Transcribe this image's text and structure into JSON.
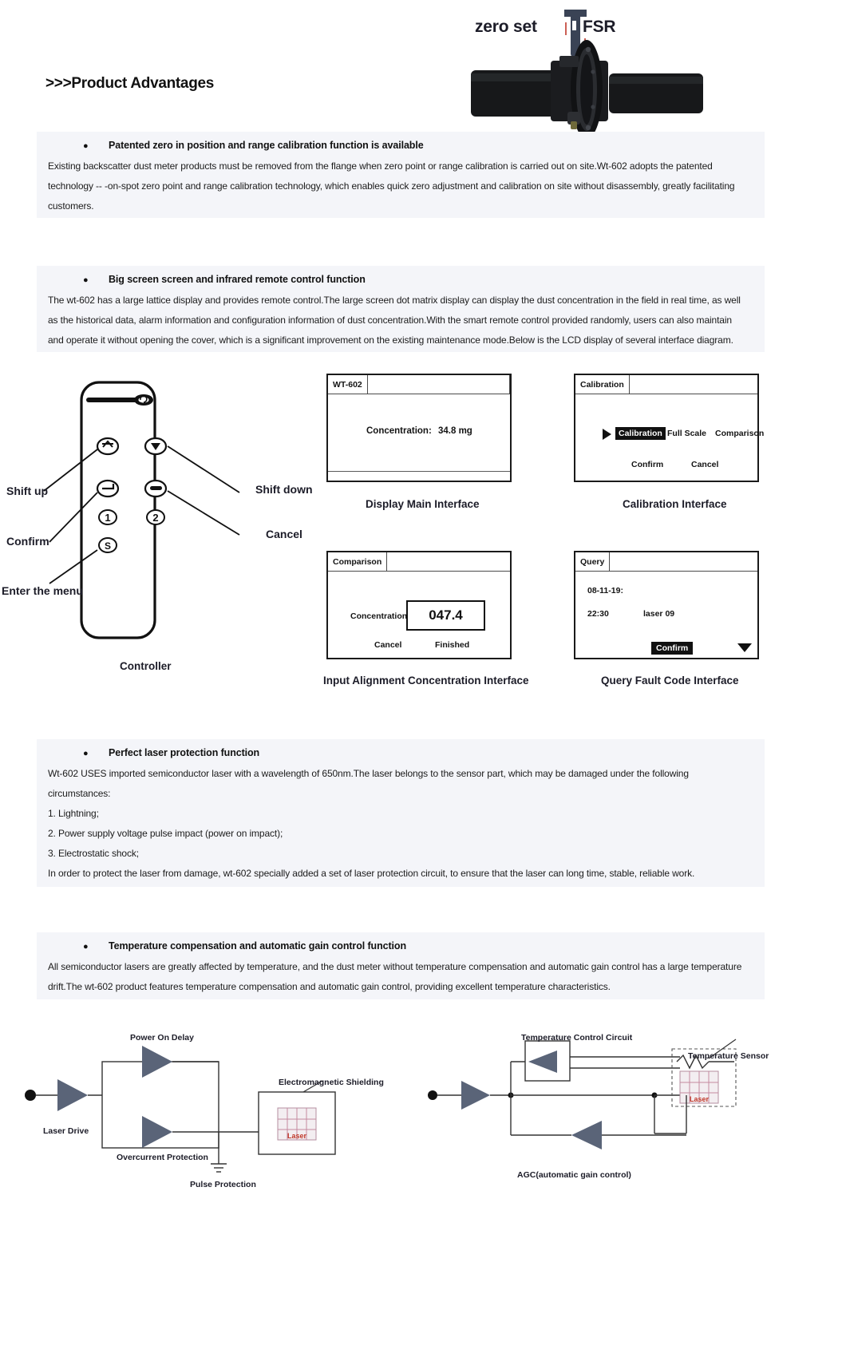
{
  "header": {
    "title": ">>>Product Advantages",
    "image_labels": {
      "zero_set": "zero set",
      "fsr": "FSR"
    }
  },
  "sections": [
    {
      "bullet": "Patented zero in position and range calibration function is available",
      "paragraph_lines": [
        "Existing backscatter dust meter products must be removed from the flange when zero point or range calibration is carried out on site.Wt-602 adopts the patented",
        "technology -- -on-spot zero point and range calibration technology, which enables quick zero adjustment and calibration on site without disassembly, greatly facilitating",
        "customers."
      ]
    },
    {
      "bullet": "Big screen screen and infrared remote control function",
      "paragraph_lines": [
        "The wt-602 has a large lattice display and provides remote control.The large screen dot matrix display can display the dust concentration in the field in real time, as well",
        "as the historical data, alarm information and configuration information of dust concentration.With the smart remote control provided randomly, users can also maintain",
        "and operate it without opening the cover, which is a significant improvement on the existing maintenance mode.Below is the LCD display of several interface diagram."
      ]
    },
    {
      "bullet": "Perfect laser protection function",
      "paragraph_lines": [
        "Wt-602 USES imported semiconductor laser with a wavelength of 650nm.The laser belongs to the sensor part, which may be damaged under the following",
        "circumstances:",
        "1. Lightning;",
        "2. Power supply voltage pulse impact (power on impact);",
        "3. Electrostatic shock;",
        "In order to protect the laser from damage, wt-602 specially added a set of laser protection circuit, to ensure that the laser can long time, stable, reliable work."
      ]
    },
    {
      "bullet": "Temperature compensation and automatic gain control function",
      "paragraph_lines": [
        "All semiconductor lasers are greatly affected by temperature, and the dust meter without temperature compensation and automatic gain control has a large temperature",
        "drift.The wt-602 product features temperature compensation and automatic gain control, providing excellent temperature characteristics."
      ]
    }
  ],
  "controller": {
    "caption": "Controller",
    "labels": {
      "shift_up": "Shift up",
      "confirm": "Confirm",
      "enter_menu": "Enter the menu",
      "shift_down": "Shift down",
      "cancel": "Cancel"
    },
    "buttons": {
      "up": "↑",
      "down": "▼",
      "back": "↵",
      "dash": "—",
      "one": "1",
      "two": "2",
      "s": "S"
    }
  },
  "lcd_panels": {
    "main": {
      "tab": "WT-602",
      "concentration_label": "Concentration:",
      "concentration_value": "34.8 mg",
      "caption": "Display Main Interface"
    },
    "calibration": {
      "tab": "Calibration",
      "selected": "Calibration",
      "option_full_scale": "Full Scale",
      "option_comparison": "Comparison",
      "confirm": "Confirm",
      "cancel": "Cancel",
      "caption": "Calibration Interface"
    },
    "comparison": {
      "tab": "Comparison",
      "concentration_label": "Concentration",
      "concentration_value": "047.4",
      "cancel": "Cancel",
      "finished": "Finished",
      "caption": "Input Alignment Concentration Interface"
    },
    "query": {
      "tab": "Query",
      "date": "08-11-19:",
      "time": "22:30",
      "code": "laser 09",
      "confirm": "Confirm",
      "caption": "Query Fault Code Interface"
    }
  },
  "diagrams": {
    "laser_protection": {
      "labels": {
        "power_on_delay": "Power On Delay",
        "electromagnetic_shielding": "Electromagnetic Shielding",
        "laser_drive": "Laser Drive",
        "overcurrent_protection": "Overcurrent Protection",
        "pulse_protection": "Pulse Protection",
        "laser": "Laser"
      }
    },
    "agc": {
      "labels": {
        "temperature_control_circuit": "Temperature Control Circuit",
        "temperature_sensor": "Temperature Sensor",
        "agc": "AGC(automatic gain control)",
        "laser": "Laser"
      }
    }
  },
  "colors": {
    "text_bg": "#f4f5f9",
    "ink": "#1a1a1a",
    "diagram_fill": "#5a6478",
    "laser_red": "#c0392b"
  }
}
